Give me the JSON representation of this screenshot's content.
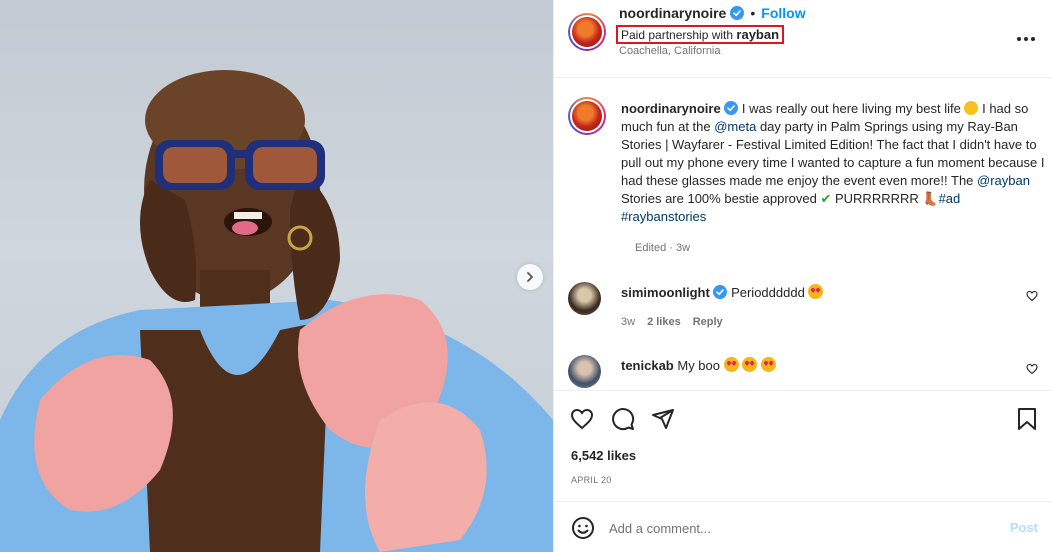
{
  "header": {
    "username": "noordinarynoire",
    "separator": "•",
    "follow_label": "Follow",
    "partnership_prefix": "Paid partnership with ",
    "partner": "rayban",
    "location": "Coachella, California"
  },
  "caption": {
    "username": "noordinarynoire",
    "part1": " I was really out here living my best life",
    "part2": " I had so much fun at the ",
    "mention_meta": "@meta",
    "part3": " day party in Palm Springs using my Ray-Ban Stories | Wayfarer - Festival Limited Edition! The fact that I didn't have to pull out my phone every time I wanted to capture a fun moment because I had these glasses made me enjoy the event even more!! The ",
    "mention_rayban": "@rayban",
    "part4": " Stories are 100% bestie approved ",
    "check_emoji": "✔",
    "part5": " PURRRRRRR ",
    "boot_emoji": "👢",
    "hashtags": "#ad #raybanstories",
    "edited": "Edited · 3w"
  },
  "comments": [
    {
      "username": "simimoonlight",
      "text": " Periodddddd",
      "time": "3w",
      "likes": "2 likes",
      "reply": "Reply"
    },
    {
      "username": "tenickab",
      "text": " My boo "
    }
  ],
  "post": {
    "likes": "6,542 likes",
    "date": "APRIL 20"
  },
  "add_comment": {
    "placeholder": "Add a comment...",
    "post_label": "Post"
  },
  "icons": {
    "verified": "verified-badge-icon",
    "more": "more-options-icon",
    "heart": "heart-icon",
    "comment": "comment-icon",
    "share": "share-icon",
    "save": "bookmark-icon",
    "emoji": "smiley-icon",
    "next": "chevron-right-icon"
  },
  "colors": {
    "accent": "#0095f6",
    "highlight_box": "#e0161d",
    "link": "#00376b",
    "muted": "#737373",
    "post_disabled": "#b2dffc"
  }
}
